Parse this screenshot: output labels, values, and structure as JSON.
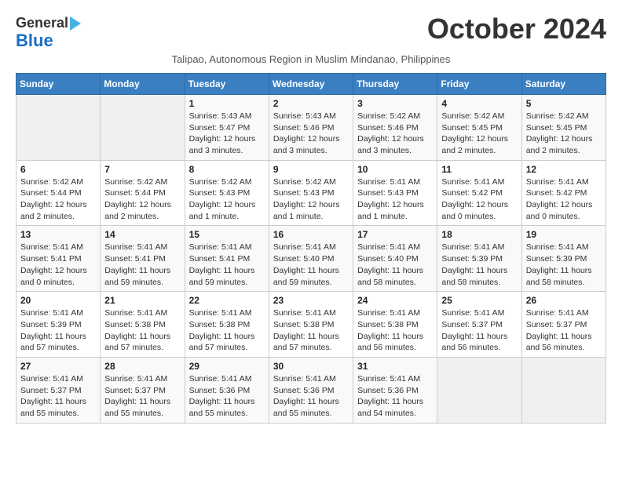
{
  "header": {
    "logo_line1": "General",
    "logo_line2": "Blue",
    "title": "October 2024",
    "subtitle": "Talipao, Autonomous Region in Muslim Mindanao, Philippines"
  },
  "calendar": {
    "weekdays": [
      "Sunday",
      "Monday",
      "Tuesday",
      "Wednesday",
      "Thursday",
      "Friday",
      "Saturday"
    ],
    "weeks": [
      [
        {
          "day": "",
          "info": ""
        },
        {
          "day": "",
          "info": ""
        },
        {
          "day": "1",
          "info": "Sunrise: 5:43 AM\nSunset: 5:47 PM\nDaylight: 12 hours and 3 minutes."
        },
        {
          "day": "2",
          "info": "Sunrise: 5:43 AM\nSunset: 5:46 PM\nDaylight: 12 hours and 3 minutes."
        },
        {
          "day": "3",
          "info": "Sunrise: 5:42 AM\nSunset: 5:46 PM\nDaylight: 12 hours and 3 minutes."
        },
        {
          "day": "4",
          "info": "Sunrise: 5:42 AM\nSunset: 5:45 PM\nDaylight: 12 hours and 2 minutes."
        },
        {
          "day": "5",
          "info": "Sunrise: 5:42 AM\nSunset: 5:45 PM\nDaylight: 12 hours and 2 minutes."
        }
      ],
      [
        {
          "day": "6",
          "info": "Sunrise: 5:42 AM\nSunset: 5:44 PM\nDaylight: 12 hours and 2 minutes."
        },
        {
          "day": "7",
          "info": "Sunrise: 5:42 AM\nSunset: 5:44 PM\nDaylight: 12 hours and 2 minutes."
        },
        {
          "day": "8",
          "info": "Sunrise: 5:42 AM\nSunset: 5:43 PM\nDaylight: 12 hours and 1 minute."
        },
        {
          "day": "9",
          "info": "Sunrise: 5:42 AM\nSunset: 5:43 PM\nDaylight: 12 hours and 1 minute."
        },
        {
          "day": "10",
          "info": "Sunrise: 5:41 AM\nSunset: 5:43 PM\nDaylight: 12 hours and 1 minute."
        },
        {
          "day": "11",
          "info": "Sunrise: 5:41 AM\nSunset: 5:42 PM\nDaylight: 12 hours and 0 minutes."
        },
        {
          "day": "12",
          "info": "Sunrise: 5:41 AM\nSunset: 5:42 PM\nDaylight: 12 hours and 0 minutes."
        }
      ],
      [
        {
          "day": "13",
          "info": "Sunrise: 5:41 AM\nSunset: 5:41 PM\nDaylight: 12 hours and 0 minutes."
        },
        {
          "day": "14",
          "info": "Sunrise: 5:41 AM\nSunset: 5:41 PM\nDaylight: 11 hours and 59 minutes."
        },
        {
          "day": "15",
          "info": "Sunrise: 5:41 AM\nSunset: 5:41 PM\nDaylight: 11 hours and 59 minutes."
        },
        {
          "day": "16",
          "info": "Sunrise: 5:41 AM\nSunset: 5:40 PM\nDaylight: 11 hours and 59 minutes."
        },
        {
          "day": "17",
          "info": "Sunrise: 5:41 AM\nSunset: 5:40 PM\nDaylight: 11 hours and 58 minutes."
        },
        {
          "day": "18",
          "info": "Sunrise: 5:41 AM\nSunset: 5:39 PM\nDaylight: 11 hours and 58 minutes."
        },
        {
          "day": "19",
          "info": "Sunrise: 5:41 AM\nSunset: 5:39 PM\nDaylight: 11 hours and 58 minutes."
        }
      ],
      [
        {
          "day": "20",
          "info": "Sunrise: 5:41 AM\nSunset: 5:39 PM\nDaylight: 11 hours and 57 minutes."
        },
        {
          "day": "21",
          "info": "Sunrise: 5:41 AM\nSunset: 5:38 PM\nDaylight: 11 hours and 57 minutes."
        },
        {
          "day": "22",
          "info": "Sunrise: 5:41 AM\nSunset: 5:38 PM\nDaylight: 11 hours and 57 minutes."
        },
        {
          "day": "23",
          "info": "Sunrise: 5:41 AM\nSunset: 5:38 PM\nDaylight: 11 hours and 57 minutes."
        },
        {
          "day": "24",
          "info": "Sunrise: 5:41 AM\nSunset: 5:38 PM\nDaylight: 11 hours and 56 minutes."
        },
        {
          "day": "25",
          "info": "Sunrise: 5:41 AM\nSunset: 5:37 PM\nDaylight: 11 hours and 56 minutes."
        },
        {
          "day": "26",
          "info": "Sunrise: 5:41 AM\nSunset: 5:37 PM\nDaylight: 11 hours and 56 minutes."
        }
      ],
      [
        {
          "day": "27",
          "info": "Sunrise: 5:41 AM\nSunset: 5:37 PM\nDaylight: 11 hours and 55 minutes."
        },
        {
          "day": "28",
          "info": "Sunrise: 5:41 AM\nSunset: 5:37 PM\nDaylight: 11 hours and 55 minutes."
        },
        {
          "day": "29",
          "info": "Sunrise: 5:41 AM\nSunset: 5:36 PM\nDaylight: 11 hours and 55 minutes."
        },
        {
          "day": "30",
          "info": "Sunrise: 5:41 AM\nSunset: 5:36 PM\nDaylight: 11 hours and 55 minutes."
        },
        {
          "day": "31",
          "info": "Sunrise: 5:41 AM\nSunset: 5:36 PM\nDaylight: 11 hours and 54 minutes."
        },
        {
          "day": "",
          "info": ""
        },
        {
          "day": "",
          "info": ""
        }
      ]
    ]
  }
}
